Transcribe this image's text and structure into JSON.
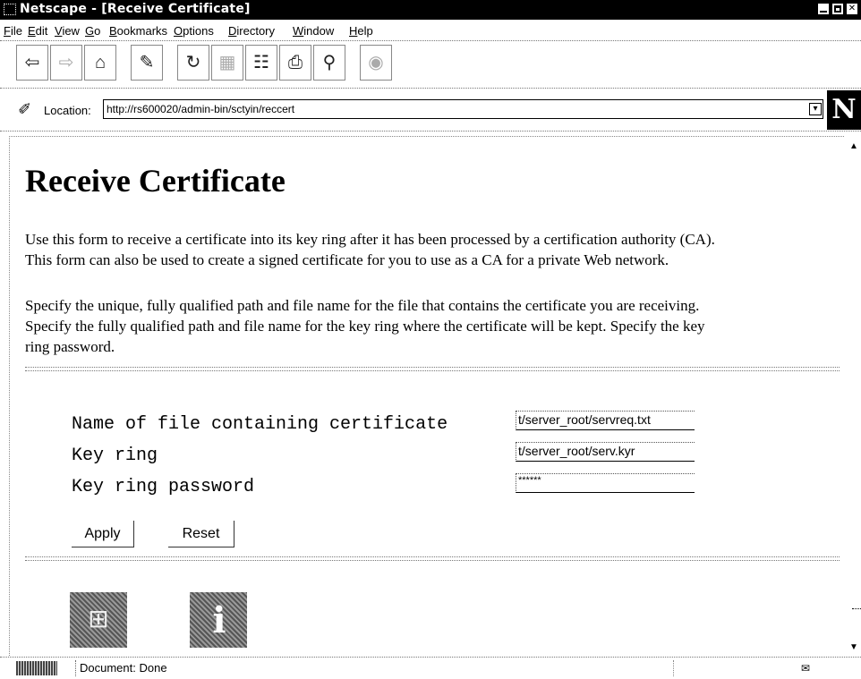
{
  "window": {
    "title": "Netscape - [Receive Certificate]"
  },
  "menu": [
    "File",
    "Edit",
    "View",
    "Go",
    "Bookmarks",
    "Options",
    "Directory",
    "Window",
    "Help"
  ],
  "toolbar": {
    "icons": [
      "back-icon",
      "forward-icon",
      "home-icon",
      "edit-icon",
      "reload-icon",
      "images-icon",
      "open-icon",
      "print-icon",
      "find-icon",
      "stop-icon"
    ]
  },
  "location": {
    "label": "Location:",
    "url": "http://rs600020/admin-bin/sctyin/reccert"
  },
  "brand": {
    "letter": "N"
  },
  "page": {
    "heading": "Receive Certificate",
    "para1_line1": "Use this form to receive a certificate into its key ring after it has been processed by a certification authority (CA).",
    "para1_line2": "This form can also be used to create a signed certificate for you to use as a CA for a private Web network.",
    "para2_line1": "Specify the unique, fully qualified path and file name for the file that contains the certificate you are receiving.",
    "para2_line2": "Specify the fully qualified path and file name for the key ring where the certificate will be kept. Specify the key",
    "para2_line3": "ring password."
  },
  "form": {
    "cert_file_label": "Name of file containing certificate",
    "cert_file_value": "t/server_root/servreq.txt",
    "keyring_label": "Key ring",
    "keyring_value": "t/server_root/serv.kyr",
    "password_label": "Key ring password",
    "password_value": "******",
    "apply_label": "Apply",
    "reset_label": "Reset"
  },
  "status": {
    "text": "Document: Done"
  }
}
